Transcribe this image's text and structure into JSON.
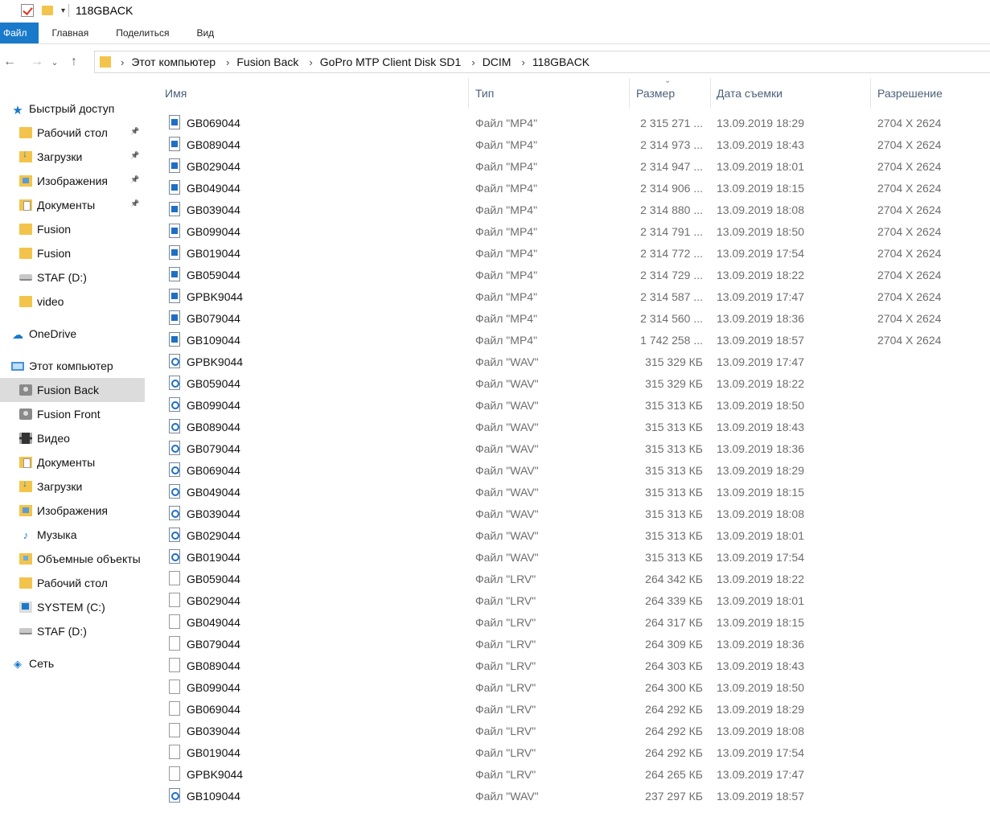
{
  "window": {
    "title": "118GBACK"
  },
  "ribbon": {
    "tabs": [
      "Файл",
      "Главная",
      "Поделиться",
      "Вид"
    ]
  },
  "address": {
    "crumbs": [
      "Этот компьютер",
      "Fusion Back",
      "GoPro MTP Client Disk SD1",
      "DCIM",
      "118GBACK"
    ]
  },
  "sidebar": {
    "items": [
      {
        "label": "Быстрый доступ",
        "icon": "star-icon",
        "pinned": false
      },
      {
        "label": "Рабочий стол",
        "icon": "folder-icon",
        "pinned": true
      },
      {
        "label": "Загрузки",
        "icon": "downloads-folder-icon",
        "pinned": true
      },
      {
        "label": "Изображения",
        "icon": "pictures-folder-icon",
        "pinned": true
      },
      {
        "label": "Документы",
        "icon": "documents-folder-icon",
        "pinned": true
      },
      {
        "label": "Fusion",
        "icon": "folder-icon",
        "pinned": false
      },
      {
        "label": "Fusion",
        "icon": "folder-icon",
        "pinned": false
      },
      {
        "label": "STAF (D:)",
        "icon": "drive-icon",
        "pinned": false
      },
      {
        "label": "video",
        "icon": "folder-icon",
        "pinned": false
      },
      {
        "label": "OneDrive",
        "icon": "cloud-icon",
        "pinned": false
      },
      {
        "label": "Этот компьютер",
        "icon": "computer-icon",
        "pinned": false
      },
      {
        "label": "Fusion Back",
        "icon": "camera-icon",
        "pinned": false,
        "selected": true
      },
      {
        "label": "Fusion Front",
        "icon": "camera-icon",
        "pinned": false
      },
      {
        "label": "Видео",
        "icon": "video-folder-icon",
        "pinned": false
      },
      {
        "label": "Документы",
        "icon": "documents-folder-icon",
        "pinned": false
      },
      {
        "label": "Загрузки",
        "icon": "downloads-folder-icon",
        "pinned": false
      },
      {
        "label": "Изображения",
        "icon": "pictures-folder-icon",
        "pinned": false
      },
      {
        "label": "Музыка",
        "icon": "music-folder-icon",
        "pinned": false
      },
      {
        "label": "Объемные объекты",
        "icon": "3d-objects-folder-icon",
        "pinned": false
      },
      {
        "label": "Рабочий стол",
        "icon": "folder-icon",
        "pinned": false
      },
      {
        "label": "SYSTEM (C:)",
        "icon": "windows-drive-icon",
        "pinned": false
      },
      {
        "label": "STAF (D:)",
        "icon": "drive-icon",
        "pinned": false
      },
      {
        "label": "Сеть",
        "icon": "network-icon",
        "pinned": false
      }
    ]
  },
  "columns": {
    "name": "Имя",
    "type": "Тип",
    "size": "Размер",
    "date": "Дата съемки",
    "resolution": "Разрешение"
  },
  "files": [
    {
      "name": "GB069044",
      "kind": "mp4",
      "type": "Файл \"MP4\"",
      "size": "2 315 271 ...",
      "date": "13.09.2019 18:29",
      "res": "2704 X 2624"
    },
    {
      "name": "GB089044",
      "kind": "mp4",
      "type": "Файл \"MP4\"",
      "size": "2 314 973 ...",
      "date": "13.09.2019 18:43",
      "res": "2704 X 2624"
    },
    {
      "name": "GB029044",
      "kind": "mp4",
      "type": "Файл \"MP4\"",
      "size": "2 314 947 ...",
      "date": "13.09.2019 18:01",
      "res": "2704 X 2624"
    },
    {
      "name": "GB049044",
      "kind": "mp4",
      "type": "Файл \"MP4\"",
      "size": "2 314 906 ...",
      "date": "13.09.2019 18:15",
      "res": "2704 X 2624"
    },
    {
      "name": "GB039044",
      "kind": "mp4",
      "type": "Файл \"MP4\"",
      "size": "2 314 880 ...",
      "date": "13.09.2019 18:08",
      "res": "2704 X 2624"
    },
    {
      "name": "GB099044",
      "kind": "mp4",
      "type": "Файл \"MP4\"",
      "size": "2 314 791 ...",
      "date": "13.09.2019 18:50",
      "res": "2704 X 2624"
    },
    {
      "name": "GB019044",
      "kind": "mp4",
      "type": "Файл \"MP4\"",
      "size": "2 314 772 ...",
      "date": "13.09.2019 17:54",
      "res": "2704 X 2624"
    },
    {
      "name": "GB059044",
      "kind": "mp4",
      "type": "Файл \"MP4\"",
      "size": "2 314 729 ...",
      "date": "13.09.2019 18:22",
      "res": "2704 X 2624"
    },
    {
      "name": "GPBK9044",
      "kind": "mp4",
      "type": "Файл \"MP4\"",
      "size": "2 314 587 ...",
      "date": "13.09.2019 17:47",
      "res": "2704 X 2624"
    },
    {
      "name": "GB079044",
      "kind": "mp4",
      "type": "Файл \"MP4\"",
      "size": "2 314 560 ...",
      "date": "13.09.2019 18:36",
      "res": "2704 X 2624"
    },
    {
      "name": "GB109044",
      "kind": "mp4",
      "type": "Файл \"MP4\"",
      "size": "1 742 258 ...",
      "date": "13.09.2019 18:57",
      "res": "2704 X 2624"
    },
    {
      "name": "GPBK9044",
      "kind": "wav",
      "type": "Файл \"WAV\"",
      "size": "315 329 КБ",
      "date": "13.09.2019 17:47",
      "res": ""
    },
    {
      "name": "GB059044",
      "kind": "wav",
      "type": "Файл \"WAV\"",
      "size": "315 329 КБ",
      "date": "13.09.2019 18:22",
      "res": ""
    },
    {
      "name": "GB099044",
      "kind": "wav",
      "type": "Файл \"WAV\"",
      "size": "315 313 КБ",
      "date": "13.09.2019 18:50",
      "res": ""
    },
    {
      "name": "GB089044",
      "kind": "wav",
      "type": "Файл \"WAV\"",
      "size": "315 313 КБ",
      "date": "13.09.2019 18:43",
      "res": ""
    },
    {
      "name": "GB079044",
      "kind": "wav",
      "type": "Файл \"WAV\"",
      "size": "315 313 КБ",
      "date": "13.09.2019 18:36",
      "res": ""
    },
    {
      "name": "GB069044",
      "kind": "wav",
      "type": "Файл \"WAV\"",
      "size": "315 313 КБ",
      "date": "13.09.2019 18:29",
      "res": ""
    },
    {
      "name": "GB049044",
      "kind": "wav",
      "type": "Файл \"WAV\"",
      "size": "315 313 КБ",
      "date": "13.09.2019 18:15",
      "res": ""
    },
    {
      "name": "GB039044",
      "kind": "wav",
      "type": "Файл \"WAV\"",
      "size": "315 313 КБ",
      "date": "13.09.2019 18:08",
      "res": ""
    },
    {
      "name": "GB029044",
      "kind": "wav",
      "type": "Файл \"WAV\"",
      "size": "315 313 КБ",
      "date": "13.09.2019 18:01",
      "res": ""
    },
    {
      "name": "GB019044",
      "kind": "wav",
      "type": "Файл \"WAV\"",
      "size": "315 313 КБ",
      "date": "13.09.2019 17:54",
      "res": ""
    },
    {
      "name": "GB059044",
      "kind": "lrv",
      "type": "Файл \"LRV\"",
      "size": "264 342 КБ",
      "date": "13.09.2019 18:22",
      "res": ""
    },
    {
      "name": "GB029044",
      "kind": "lrv",
      "type": "Файл \"LRV\"",
      "size": "264 339 КБ",
      "date": "13.09.2019 18:01",
      "res": ""
    },
    {
      "name": "GB049044",
      "kind": "lrv",
      "type": "Файл \"LRV\"",
      "size": "264 317 КБ",
      "date": "13.09.2019 18:15",
      "res": ""
    },
    {
      "name": "GB079044",
      "kind": "lrv",
      "type": "Файл \"LRV\"",
      "size": "264 309 КБ",
      "date": "13.09.2019 18:36",
      "res": ""
    },
    {
      "name": "GB089044",
      "kind": "lrv",
      "type": "Файл \"LRV\"",
      "size": "264 303 КБ",
      "date": "13.09.2019 18:43",
      "res": ""
    },
    {
      "name": "GB099044",
      "kind": "lrv",
      "type": "Файл \"LRV\"",
      "size": "264 300 КБ",
      "date": "13.09.2019 18:50",
      "res": ""
    },
    {
      "name": "GB069044",
      "kind": "lrv",
      "type": "Файл \"LRV\"",
      "size": "264 292 КБ",
      "date": "13.09.2019 18:29",
      "res": ""
    },
    {
      "name": "GB039044",
      "kind": "lrv",
      "type": "Файл \"LRV\"",
      "size": "264 292 КБ",
      "date": "13.09.2019 18:08",
      "res": ""
    },
    {
      "name": "GB019044",
      "kind": "lrv",
      "type": "Файл \"LRV\"",
      "size": "264 292 КБ",
      "date": "13.09.2019 17:54",
      "res": ""
    },
    {
      "name": "GPBK9044",
      "kind": "lrv",
      "type": "Файл \"LRV\"",
      "size": "264 265 КБ",
      "date": "13.09.2019 17:47",
      "res": ""
    },
    {
      "name": "GB109044",
      "kind": "wav",
      "type": "Файл \"WAV\"",
      "size": "237 297 КБ",
      "date": "13.09.2019 18:57",
      "res": ""
    }
  ]
}
